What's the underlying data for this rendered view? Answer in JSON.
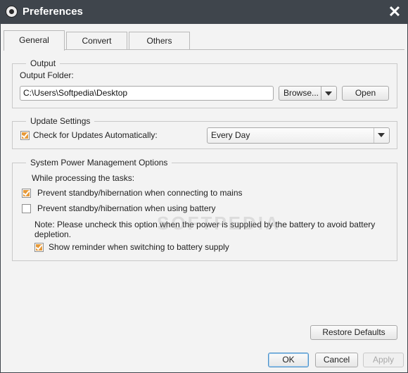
{
  "window": {
    "title": "Preferences",
    "icon": "app-speaker-icon",
    "close_icon": "close-icon"
  },
  "tabs": [
    {
      "label": "General",
      "active": true
    },
    {
      "label": "Convert",
      "active": false
    },
    {
      "label": "Others",
      "active": false
    }
  ],
  "output": {
    "legend": "Output",
    "folder_label": "Output Folder:",
    "folder_value": "C:\\Users\\Softpedia\\Desktop",
    "browse_label": "Browse...",
    "open_label": "Open"
  },
  "update": {
    "legend": "Update Settings",
    "check_label": "Check for Updates Automatically:",
    "check_on": true,
    "frequency": "Every Day"
  },
  "power": {
    "legend": "System Power Management Options",
    "intro": "While processing the tasks:",
    "mains_label": "Prevent standby/hibernation when connecting to mains",
    "mains_on": true,
    "battery_label": "Prevent standby/hibernation when using battery",
    "battery_on": false,
    "note_line1": "Note: Please uncheck this option when the power is supplied by the battery to avoid battery",
    "note_line2": "depletion.",
    "reminder_label": "Show reminder when switching to battery supply",
    "reminder_on": true
  },
  "watermark": "SOFTPEDIA",
  "footer": {
    "restore_label": "Restore Defaults",
    "ok_label": "OK",
    "cancel_label": "Cancel",
    "apply_label": "Apply",
    "apply_enabled": false
  },
  "colors": {
    "titlebar": "#3f454c",
    "check_accent": "#e69a3a",
    "default_button_border": "#4a90c8"
  }
}
